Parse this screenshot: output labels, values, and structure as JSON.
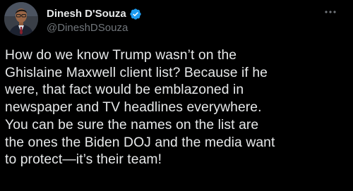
{
  "author": {
    "display_name": "Dinesh D'Souza",
    "handle": "@DineshDSouza",
    "verified": true,
    "avatar_icon": "user-avatar",
    "verified_icon": "verified-badge-icon"
  },
  "menu": {
    "icon": "more-horizontal-icon"
  },
  "tweet": {
    "lines": [
      "How do we know Trump wasn’t on the",
      "Ghislaine Maxwell client list? Because if he",
      "were, that fact would be emblazoned in",
      "newspaper and TV headlines everywhere.",
      "You can be sure the names on the list are",
      "the ones the Biden DOJ and the media want",
      "to protect—it’s their team!"
    ]
  },
  "colors": {
    "background": "#000000",
    "text_primary": "#e7e9ea",
    "text_secondary": "#71767b",
    "verified": "#1d9bf0"
  }
}
